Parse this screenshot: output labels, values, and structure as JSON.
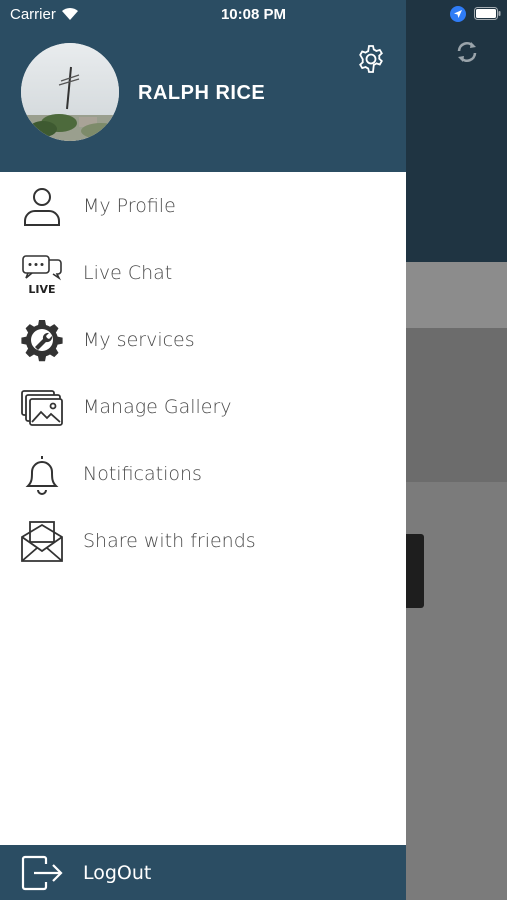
{
  "status_bar": {
    "carrier": "Carrier",
    "time": "10:08 PM"
  },
  "drawer": {
    "user_name": "RALPH RICE",
    "settings_icon": "gear-icon",
    "menu": [
      {
        "label": "My Profile",
        "icon": "user-icon"
      },
      {
        "label": "Live Chat",
        "icon": "live-chat-icon"
      },
      {
        "label": "My services",
        "icon": "services-gear-wrench-icon"
      },
      {
        "label": "Manage Gallery",
        "icon": "gallery-icon"
      },
      {
        "label": "Notifications",
        "icon": "bell-icon"
      },
      {
        "label": "Share with friends",
        "icon": "envelope-icon"
      }
    ],
    "footer": {
      "label": "LogOut",
      "icon": "logout-icon"
    }
  },
  "colors": {
    "drawer_header": "#2b4d63",
    "background_header": "#1f3442",
    "menu_text": "#4a4a4a"
  }
}
